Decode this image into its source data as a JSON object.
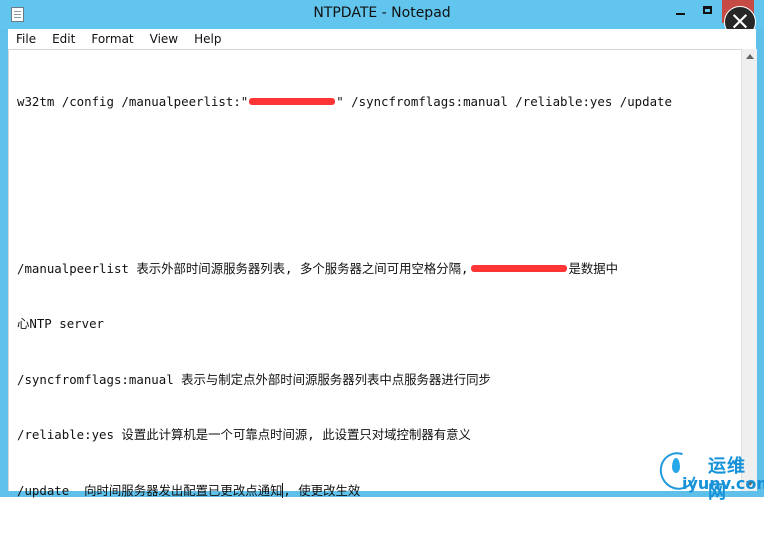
{
  "window": {
    "title": "NTPDATE - Notepad",
    "overlay_close_glyph": "×",
    "colors": {
      "titlebar": "#62c5ee",
      "close": "#c74b45",
      "redaction": "#ff3535",
      "watermark": "#1592d8"
    }
  },
  "menu": {
    "items": [
      "File",
      "Edit",
      "Format",
      "View",
      "Help"
    ]
  },
  "editor": {
    "lines": [
      {
        "segments": [
          "w32tm /config /manualpeerlist:\"",
          "\" /syncfromflags:manual /reliable:yes /update"
        ]
      },
      {
        "text": ""
      },
      {
        "text": ""
      },
      {
        "segments": [
          "/manualpeerlist 表示外部时间源服务器列表, 多个服务器之间可用空格分隔,",
          "是数据中"
        ]
      },
      {
        "text": "心NTP server"
      },
      {
        "text": "/syncfromflags:manual 表示与制定点外部时间源服务器列表中点服务器进行同步"
      },
      {
        "text": "/reliable:yes 设置此计算机是一个可靠点时间源, 此设置只对域控制器有意义"
      },
      {
        "segments": [
          "/update  向时间服务器发出配置已更改点通知",
          ", 使更改生效"
        ]
      }
    ]
  },
  "watermark": {
    "chinese": "运维网",
    "domain": "iyunv.com"
  }
}
